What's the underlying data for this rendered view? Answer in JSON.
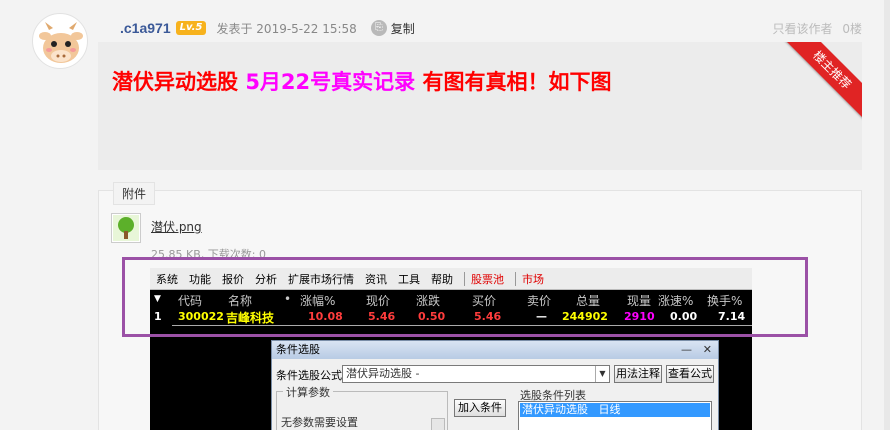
{
  "post": {
    "author": ".c1a971",
    "level": "Lv.5",
    "posted_label": "发表于",
    "posted_time": "2019-5-22 15:58",
    "copy_label": "复制",
    "only_author": "只看该作者",
    "floor": "0楼",
    "ribbon": "楼主推荐",
    "title_part1": "潜伏异动选股",
    "title_part2": "5月22号真实记录",
    "title_part3": "有图有真相！如下图"
  },
  "attachment": {
    "tab": "附件",
    "file_name": "潜伏.png",
    "file_meta": "25.85 KB, 下载次数: 0"
  },
  "app": {
    "menu": [
      "系统",
      "功能",
      "报价",
      "分析",
      "扩展市场行情",
      "资讯",
      "工具",
      "帮助"
    ],
    "menu_red": [
      "股票池",
      "市场"
    ],
    "columns": [
      "代码",
      "名称",
      "•",
      "涨幅%",
      "现价",
      "涨跌",
      "买价",
      "卖价",
      "总量",
      "现量",
      "涨速%",
      "换手%"
    ],
    "row": {
      "index": "1",
      "code": "300022",
      "name": "吉峰科技",
      "change_pct": "10.08",
      "price": "5.46",
      "change": "0.50",
      "bid": "5.46",
      "ask": "—",
      "volume": "244902",
      "current_vol": "2910",
      "speed": "0.00",
      "turnover": "7.14"
    },
    "colors": {
      "yellow": "#ffff00",
      "red": "#ff3c3c",
      "magenta": "#ff00ff",
      "white": "#ffffff"
    }
  },
  "dialog": {
    "title": "条件选股",
    "minimize": "—",
    "close": "✕",
    "formula_label": "条件选股公式",
    "formula_value": "潜伏异动选股 -",
    "btn_usage": "用法注释",
    "btn_view": "查看公式",
    "calc_title": "计算参数",
    "calc_text": "无参数需要设置",
    "btn_add": "加入条件",
    "list_label": "选股条件列表",
    "list_item": "潜伏异动选股   日线"
  }
}
